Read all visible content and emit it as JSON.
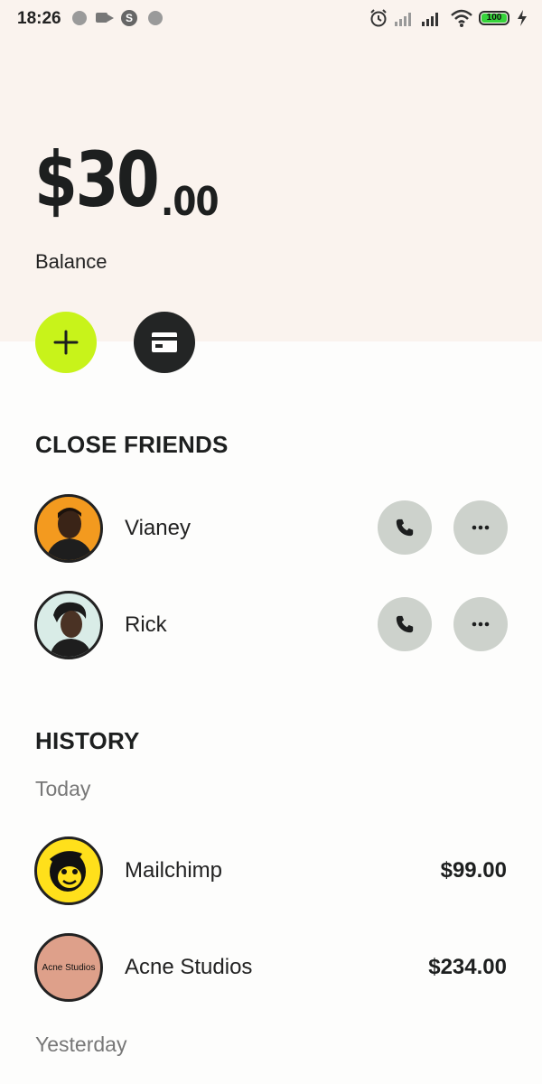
{
  "status_bar": {
    "time": "18:26",
    "battery": "100",
    "icons": [
      "notification-dot-icon",
      "video-camera-icon",
      "s-app-icon",
      "notification-dot-icon",
      "alarm-icon",
      "signal-icon",
      "signal-icon",
      "wifi-icon",
      "battery-icon",
      "charging-icon"
    ]
  },
  "balance": {
    "amount_main": "$30",
    "amount_cents": ".00",
    "label": "Balance"
  },
  "actions": {
    "add_icon": "plus-icon",
    "card_icon": "credit-card-icon",
    "accent_color": "#c8f31a",
    "dark_color": "#232525"
  },
  "close_friends": {
    "title": "CLOSE FRIENDS",
    "friends": [
      {
        "name": "Vianey",
        "avatar_color": "#f39a1f"
      },
      {
        "name": "Rick",
        "avatar_color": "#d9ece7"
      }
    ]
  },
  "history": {
    "title": "HISTORY",
    "groups": [
      {
        "label": "Today",
        "items": [
          {
            "name": "Mailchimp",
            "amount": "$99.00",
            "avatar_color": "#ffe01b"
          },
          {
            "name": "Acne Studios",
            "amount": "$234.00",
            "avatar_text": "Acne Studios",
            "avatar_color": "#dea08a"
          }
        ]
      },
      {
        "label": "Yesterday",
        "items": []
      }
    ]
  }
}
